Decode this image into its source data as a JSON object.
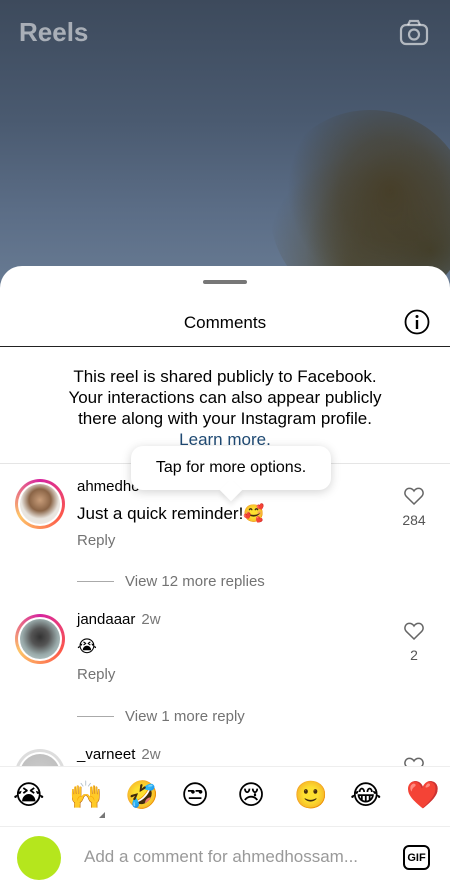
{
  "reel": {
    "title": "Reels"
  },
  "sheet": {
    "title": "Comments",
    "notice_line1": "This reel is shared publicly to Facebook.",
    "notice_line2": "Your interactions can also appear publicly",
    "notice_line3": "there along with your Instagram profile.",
    "notice_link": "Learn more."
  },
  "tooltip": {
    "text": "Tap for more options."
  },
  "comments": [
    {
      "username": "ahmedho",
      "time": "",
      "text": "Just a quick reminder!🥰",
      "reply": "Reply",
      "likes": "284",
      "view_replies": "View 12 more replies"
    },
    {
      "username": "jandaaar",
      "time": "2w",
      "text": "😭",
      "reply": "Reply",
      "likes": "2",
      "view_replies": "View 1 more reply"
    },
    {
      "username": "_varneet",
      "time": "2w"
    }
  ],
  "emojis": [
    "😭",
    "🙌",
    "🤣",
    "😒",
    "😢",
    "🙂",
    "😂",
    "❤️"
  ],
  "composer": {
    "placeholder": "Add a comment for ahmedhossam...",
    "gif_label": "GIF"
  },
  "colors": {
    "accent_link": "#1f4a73",
    "composer_avatar": "#b5e61d"
  }
}
